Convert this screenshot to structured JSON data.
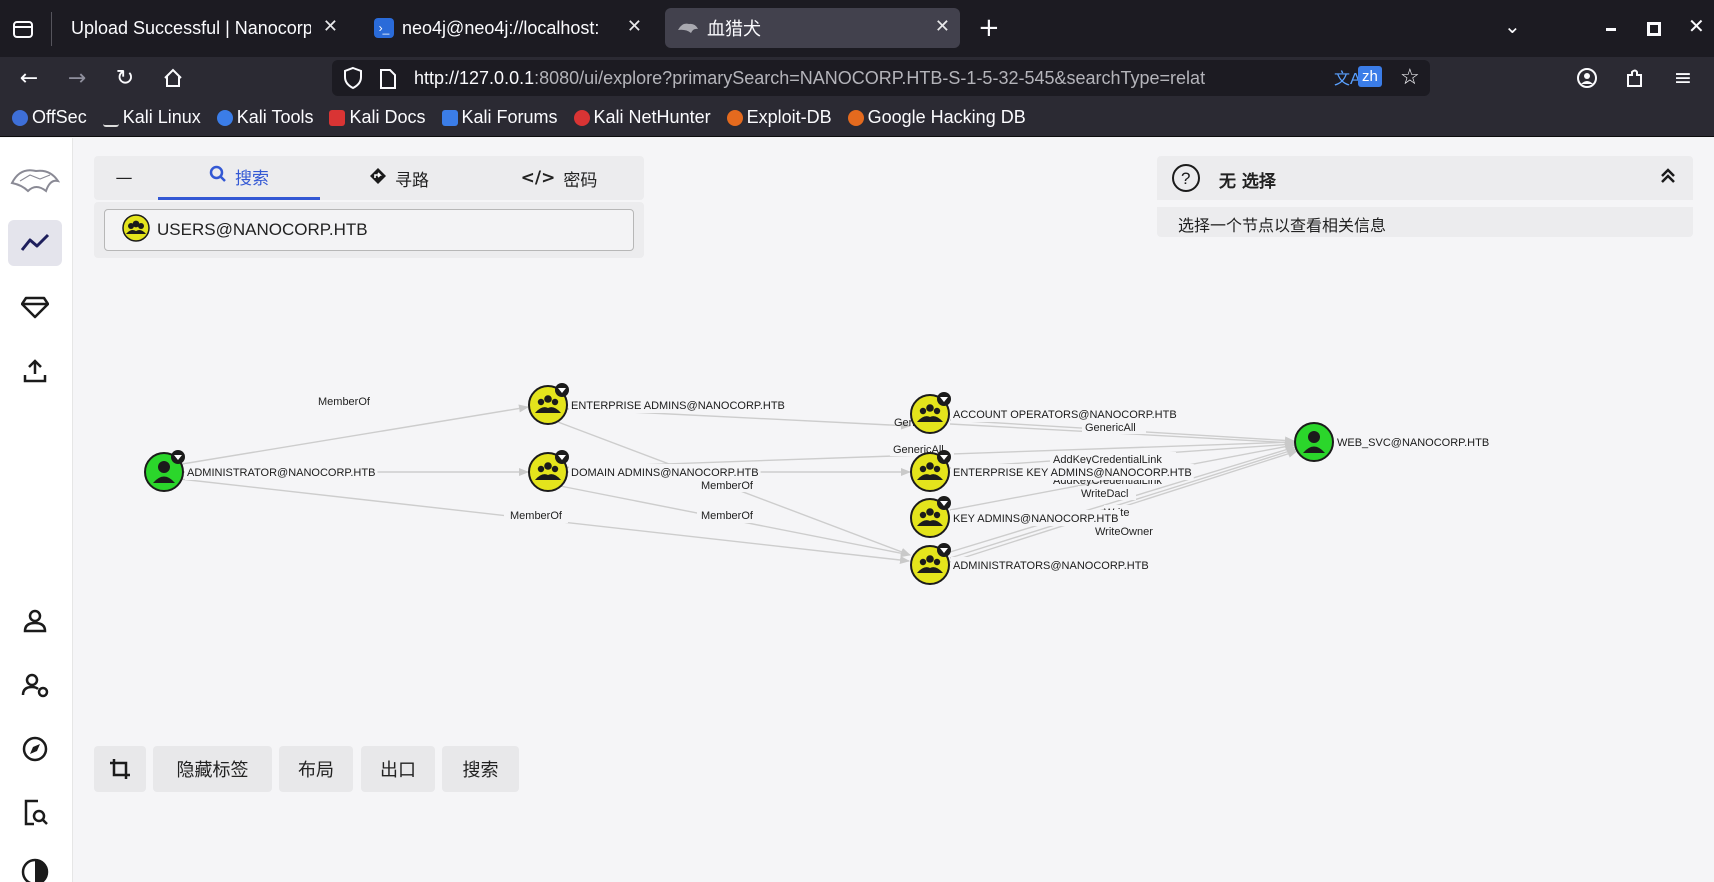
{
  "browser": {
    "tabs": [
      {
        "title": "Upload Successful | Nanocorp",
        "active": false
      },
      {
        "title": "neo4j@neo4j://localhost:",
        "active": false
      },
      {
        "title": "血猎犬",
        "active": true
      }
    ],
    "url_host": "http://127.0.0.1",
    "url_rest": ":8080/ui/explore?primarySearch=NANOCORP.HTB-S-1-5-32-545&searchType=relat",
    "translate_badge": "zh",
    "bookmarks": [
      "OffSec",
      "Kali Linux",
      "Kali Tools",
      "Kali Docs",
      "Kali Forums",
      "Kali NetHunter",
      "Exploit-DB",
      "Google Hacking DB"
    ]
  },
  "search_panel": {
    "collapse_label": "—",
    "tabs": [
      {
        "label": "搜索",
        "active": true
      },
      {
        "label": "寻路",
        "active": false
      },
      {
        "label": "密码",
        "active": false
      }
    ],
    "selected_node": "USERS@NANOCORP.HTB"
  },
  "info_panel": {
    "title": "无 选择",
    "hint": "选择一个节点以查看相关信息"
  },
  "bottom_toolbar": {
    "hide_labels": "隐藏标签",
    "layout": "布局",
    "export": "出口",
    "search": "搜索"
  },
  "colors": {
    "user_node": "#2bd62b",
    "group_node": "#e4e41c",
    "accent": "#3358d4"
  },
  "graph": {
    "nodes": [
      {
        "id": "admin",
        "label": "ADMINISTRATOR@NANOCORP.HTB",
        "kind": "user"
      },
      {
        "id": "ea",
        "label": "ENTERPRISE ADMINS@NANOCORP.HTB",
        "kind": "group"
      },
      {
        "id": "da",
        "label": "DOMAIN ADMINS@NANOCORP.HTB",
        "kind": "group"
      },
      {
        "id": "ao",
        "label": "ACCOUNT OPERATORS@NANOCORP.HTB",
        "kind": "group"
      },
      {
        "id": "eka",
        "label": "ENTERPRISE KEY ADMINS@NANOCORP.HTB",
        "kind": "group"
      },
      {
        "id": "ka",
        "label": "KEY ADMINS@NANOCORP.HTB",
        "kind": "group"
      },
      {
        "id": "adms",
        "label": "ADMINISTRATORS@NANOCORP.HTB",
        "kind": "group"
      },
      {
        "id": "web",
        "label": "WEB_SVC@NANOCORP.HTB",
        "kind": "user"
      }
    ],
    "edge_labels": {
      "memberof_1": "MemberOf",
      "memberof_2": "MemberOf",
      "memberof_3": "MemberOf",
      "memberof_4": "MemberOf",
      "genericall_1": "GenericAll",
      "genericall_2": "GenericAll",
      "genericall_3": "Gen",
      "addkey_1": "AddKeyCredentialLink",
      "addkey_2": "AddKeyCredentialLink",
      "writedacl": "WriteDacl",
      "write": "Write",
      "writeowner": "WriteOwner"
    }
  }
}
